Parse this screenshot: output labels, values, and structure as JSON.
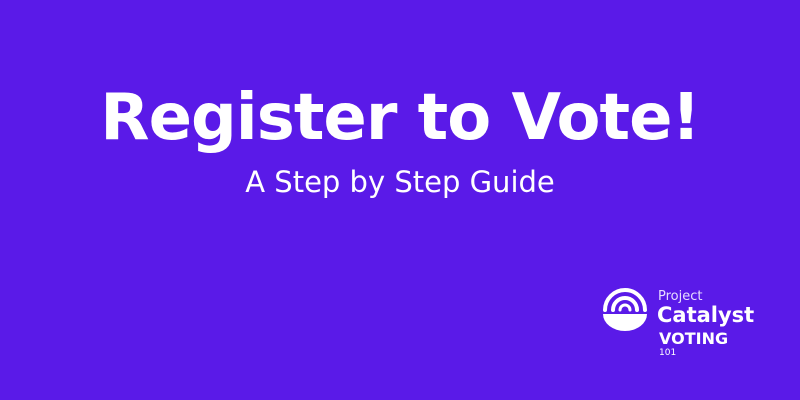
{
  "banner": {
    "background_color": "#5a1ae8",
    "title": "Register to Vote!",
    "subtitle": "A Step by Step Guide"
  },
  "logo": {
    "icon": "catalyst-rainbow-icon",
    "project": "Project",
    "catalyst": "Catalyst",
    "voting": "VOTING",
    "number": "101"
  }
}
